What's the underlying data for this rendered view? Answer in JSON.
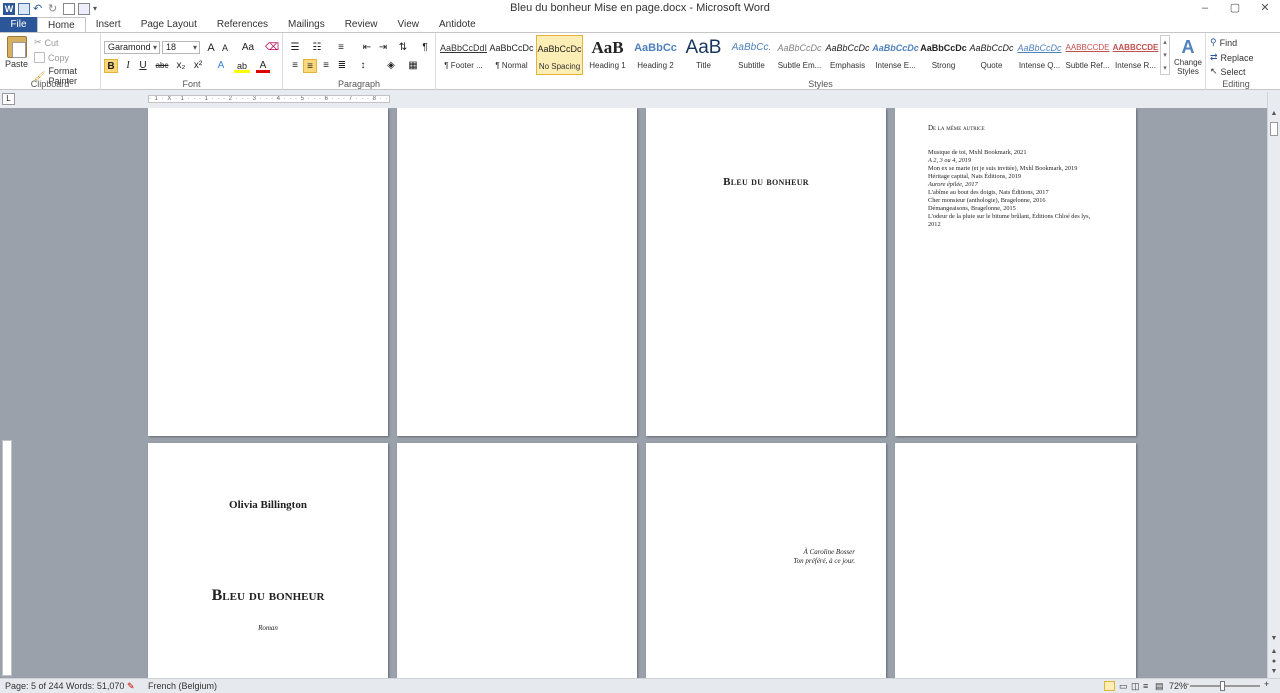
{
  "window": {
    "title": "Bleu du bonheur Mise en page.docx  -  Microsoft Word",
    "app_icon_letter": "W",
    "controls": [
      "–",
      "▢",
      "✕"
    ]
  },
  "tabs": [
    "File",
    "Home",
    "Insert",
    "Page Layout",
    "References",
    "Mailings",
    "Review",
    "View",
    "Antidote"
  ],
  "clipboard": {
    "paste": "Paste",
    "cut": "Cut",
    "copy": "Copy",
    "format_painter": "Format Painter",
    "label": "Clipboard"
  },
  "font": {
    "family": "Garamond",
    "size": "18",
    "label": "Font",
    "grow": "A",
    "shrink": "A",
    "case": "Aa",
    "bold": "B",
    "italic": "I",
    "underline": "U",
    "strike": "abc",
    "subscript": "x₂",
    "superscript": "x²",
    "effects": "A",
    "highlight": "ab",
    "color": "A"
  },
  "paragraph": {
    "label": "Paragraph",
    "show_marks": "¶"
  },
  "styles": {
    "label": "Styles",
    "items": [
      {
        "sample": "AaBbCcDdI",
        "name": "¶ Footer ..."
      },
      {
        "sample": "AaBbCcDc",
        "name": "¶ Normal"
      },
      {
        "sample": "AaBbCcDc",
        "name": "No Spacing"
      },
      {
        "sample": "AaB",
        "name": "Heading 1"
      },
      {
        "sample": "AaBbCc",
        "name": "Heading 2"
      },
      {
        "sample": "AaB",
        "name": "Title"
      },
      {
        "sample": "AaBbCc.",
        "name": "Subtitle"
      },
      {
        "sample": "AaBbCcDc",
        "name": "Subtle Em..."
      },
      {
        "sample": "AaBbCcDc",
        "name": "Emphasis"
      },
      {
        "sample": "AaBbCcDc",
        "name": "Intense E..."
      },
      {
        "sample": "AaBbCcDc",
        "name": "Strong"
      },
      {
        "sample": "AaBbCcDc",
        "name": "Quote"
      },
      {
        "sample": "AaBbCcDc",
        "name": "Intense Q..."
      },
      {
        "sample": "AABBCCDE",
        "name": "Subtle Ref..."
      },
      {
        "sample": "AABBCCDE",
        "name": "Intense R..."
      }
    ],
    "change_styles": "Change Styles"
  },
  "editing": {
    "label": "Editing",
    "find": "Find",
    "replace": "Replace",
    "select": "Select"
  },
  "ruler": {
    "corner": "L",
    "text": "· 1 · X · 1 · · · 1 · · · 2 · · · 3 · · · 4 · · · 5 · · · 6 · · · 7 · · · 8 · · · 9 · · ·10· · · 11"
  },
  "pages": {
    "p3_title": "Bleu du bonheur",
    "p4_heading": "De la même autrice",
    "p4_list": [
      "Musique de toi, Mxhl Bookmark, 2021",
      "A 2, 3 ou 4, 2019",
      "Mon ex se marie (et je suis invitée), Mxhl Bookmark, 2019",
      "Héritage capital, Nats Éditions, 2019",
      "Aurore épilée, 2017",
      "L'abîme au bout des doigts, Nats Éditions, 2017",
      "Cher monsieur (anthologie), Bragelonne, 2016",
      "Démangeaisons, Bragelonne, 2015",
      "L'odeur de la pluie sur le bitume brûlant, Éditions Chloé des lys,",
      "2012"
    ],
    "p5_author": "Olivia Billington",
    "p5_title": "Bleu du bonheur",
    "p5_genre": "Roman",
    "p7_dedication_1": "À Caroline Bosser",
    "p7_dedication_2": "Ton préféré, à ce jour."
  },
  "status": {
    "page": "Page: 5 of 244",
    "words": "Words: 51,070",
    "language": "French (Belgium)",
    "zoom": "72%"
  }
}
